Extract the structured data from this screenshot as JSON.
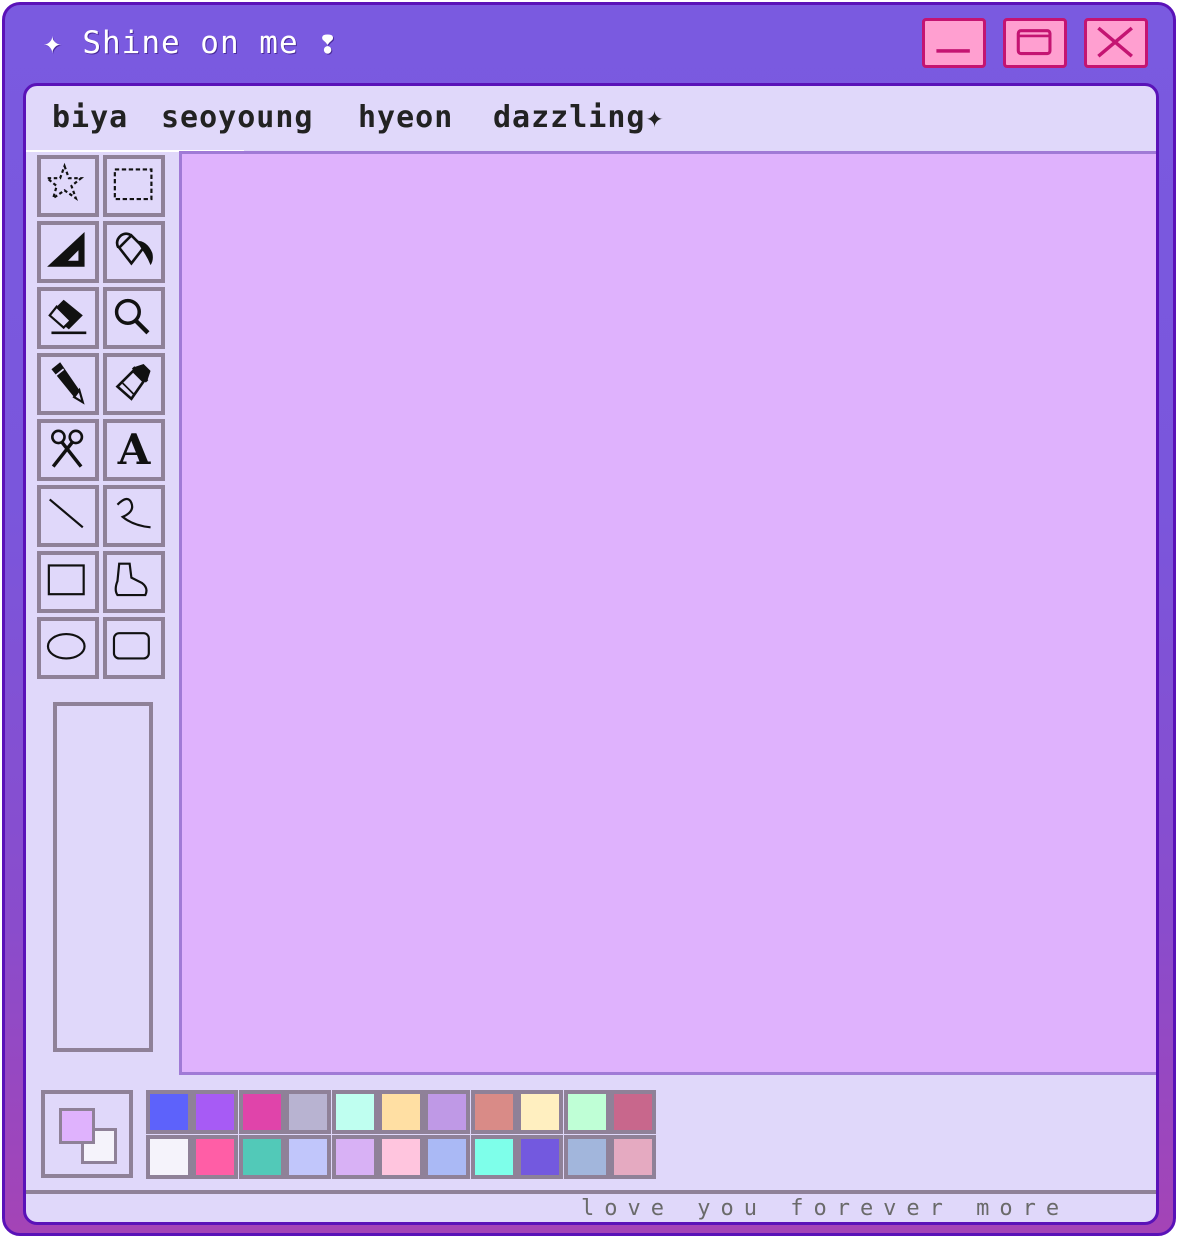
{
  "window": {
    "title": "✦ Shine on me ❢"
  },
  "menu": {
    "items": [
      "biya",
      "seoyoung",
      "hyeon",
      "dazzling✦"
    ]
  },
  "tools": [
    {
      "name": "free-select-star-icon"
    },
    {
      "name": "rect-select-icon"
    },
    {
      "name": "triangle-ruler-icon"
    },
    {
      "name": "fill-bucket-icon"
    },
    {
      "name": "eraser-icon"
    },
    {
      "name": "magnifier-icon"
    },
    {
      "name": "pencil-icon"
    },
    {
      "name": "brush-icon"
    },
    {
      "name": "scissors-icon"
    },
    {
      "name": "text-icon",
      "label": "A"
    },
    {
      "name": "line-icon"
    },
    {
      "name": "curve-icon"
    },
    {
      "name": "rectangle-icon"
    },
    {
      "name": "polygon-icon"
    },
    {
      "name": "ellipse-icon"
    },
    {
      "name": "rounded-rect-icon"
    }
  ],
  "current_colors": {
    "foreground": "#dfb2fd",
    "background": "#f5f3fb"
  },
  "palette": {
    "row1": [
      "#5d62fb",
      "#a75bf5",
      "#e044aa",
      "#b8b3d1",
      "#bffff0",
      "#ffdfa3",
      "#bf99e6",
      "#d98b87",
      "#ffefc0",
      "#bfffd6",
      "#c8678c"
    ],
    "row2": [
      "#f5f3fb",
      "#ff5ea6",
      "#52c9b8",
      "#c1c6fb",
      "#d8b1f5",
      "#ffc5de",
      "#aab9f5",
      "#7effea",
      "#7359df",
      "#a2b6dc",
      "#e5aac1"
    ]
  },
  "status": {
    "text": "love you forever more"
  },
  "colors": {
    "frame": "#7a5ae0",
    "frame_border": "#5a12b8",
    "panel": "#e0d8fa",
    "canvas": "#dfb2fd",
    "window_button": "#ff9fd0",
    "window_button_border": "#c41472"
  }
}
